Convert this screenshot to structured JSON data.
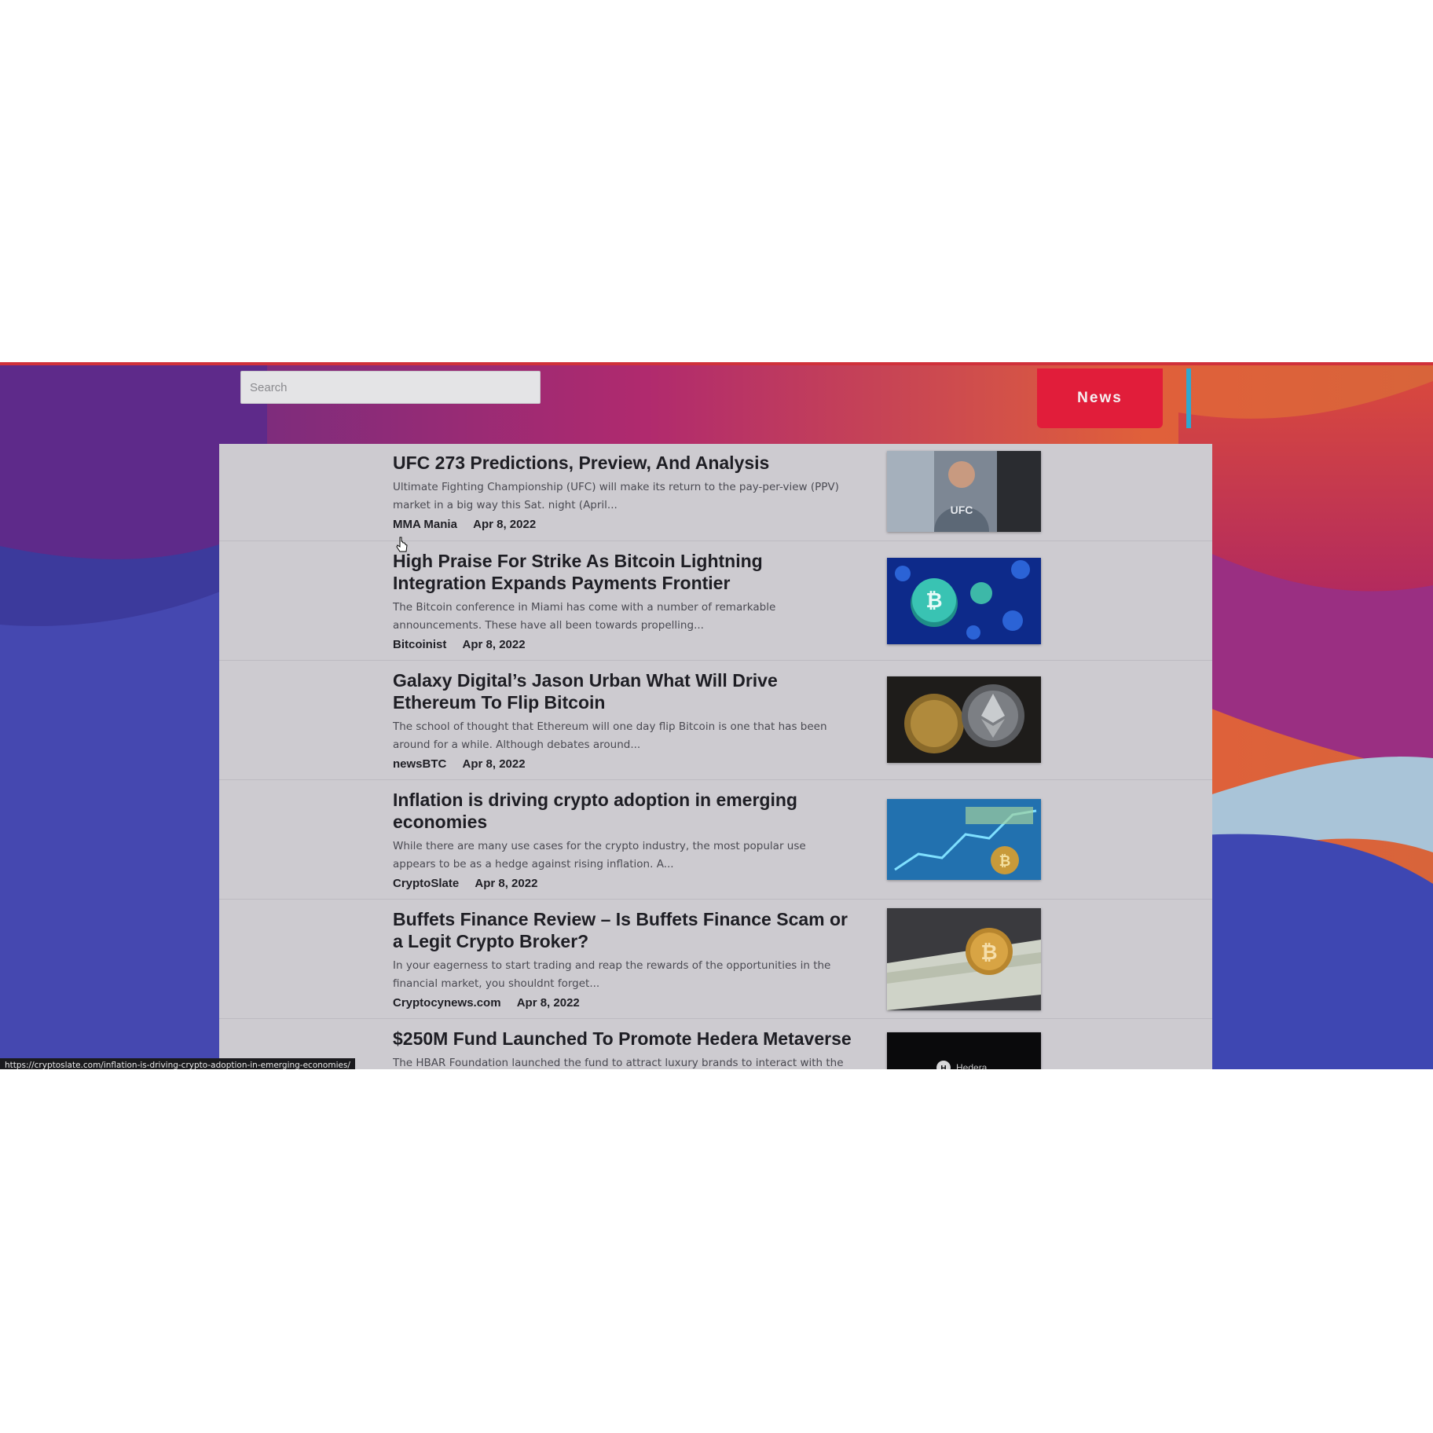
{
  "search": {
    "placeholder": "Search"
  },
  "header": {
    "news_label": "News"
  },
  "articles": [
    {
      "title": "UFC 273 Predictions, Preview, And Analysis",
      "summary": "Ultimate Fighting Championship (UFC) will make its return to the pay-per-view (PPV) market in a big way this Sat. night (April...",
      "source": "MMA Mania",
      "date": "Apr 8, 2022",
      "thumbnail": {
        "icon": "fighter-photo-icon",
        "caption": "UFC"
      }
    },
    {
      "title": "High Praise For Strike As Bitcoin Lightning Integration Expands Payments Frontier",
      "summary": "The Bitcoin conference in Miami has come with a number of remarkable announcements. These have all been towards propelling...",
      "source": "Bitcoinist",
      "date": "Apr 8, 2022",
      "thumbnail": {
        "icon": "bitcoin-network-icon"
      }
    },
    {
      "title": "Galaxy Digital’s Jason Urban What Will Drive Ethereum To Flip Bitcoin",
      "summary": "The school of thought that Ethereum will one day flip Bitcoin is one that has been around for a while. Although debates around...",
      "source": "newsBTC",
      "date": "Apr 8, 2022",
      "thumbnail": {
        "icon": "ethereum-coins-icon"
      }
    },
    {
      "title": "Inflation is driving crypto adoption in emerging economies",
      "summary": "While there are many use cases for the crypto industry, the most popular use appears to be as a hedge against rising inflation. A...",
      "source": "CryptoSlate",
      "date": "Apr 8, 2022",
      "thumbnail": {
        "icon": "inflation-chart-icon"
      }
    },
    {
      "title": "Buffets Finance Review – Is Buffets Finance Scam or a Legit Crypto Broker?",
      "summary": "In your eagerness to start trading and reap the rewards of the opportunities in the financial market, you shouldnt forget...",
      "source": "Cryptocynews.com",
      "date": "Apr 8, 2022",
      "thumbnail": {
        "icon": "cash-bitcoin-icon"
      }
    },
    {
      "title": "$250M Fund Launched To Promote Hedera Metaverse",
      "summary": "The HBAR Foundation launched the fund to attract luxury brands to interact with the",
      "source": "",
      "date": "",
      "thumbnail": {
        "icon": "hedera-logo-icon",
        "caption": "Hedera"
      }
    }
  ],
  "status_bar": {
    "url": "https://cryptoslate.com/inflation-is-driving-crypto-adoption-in-emerging-economies/"
  },
  "colors": {
    "news_button": "#e11d3a",
    "feed_panel": "#cdcbd0",
    "frame_border": "#d0303a"
  }
}
